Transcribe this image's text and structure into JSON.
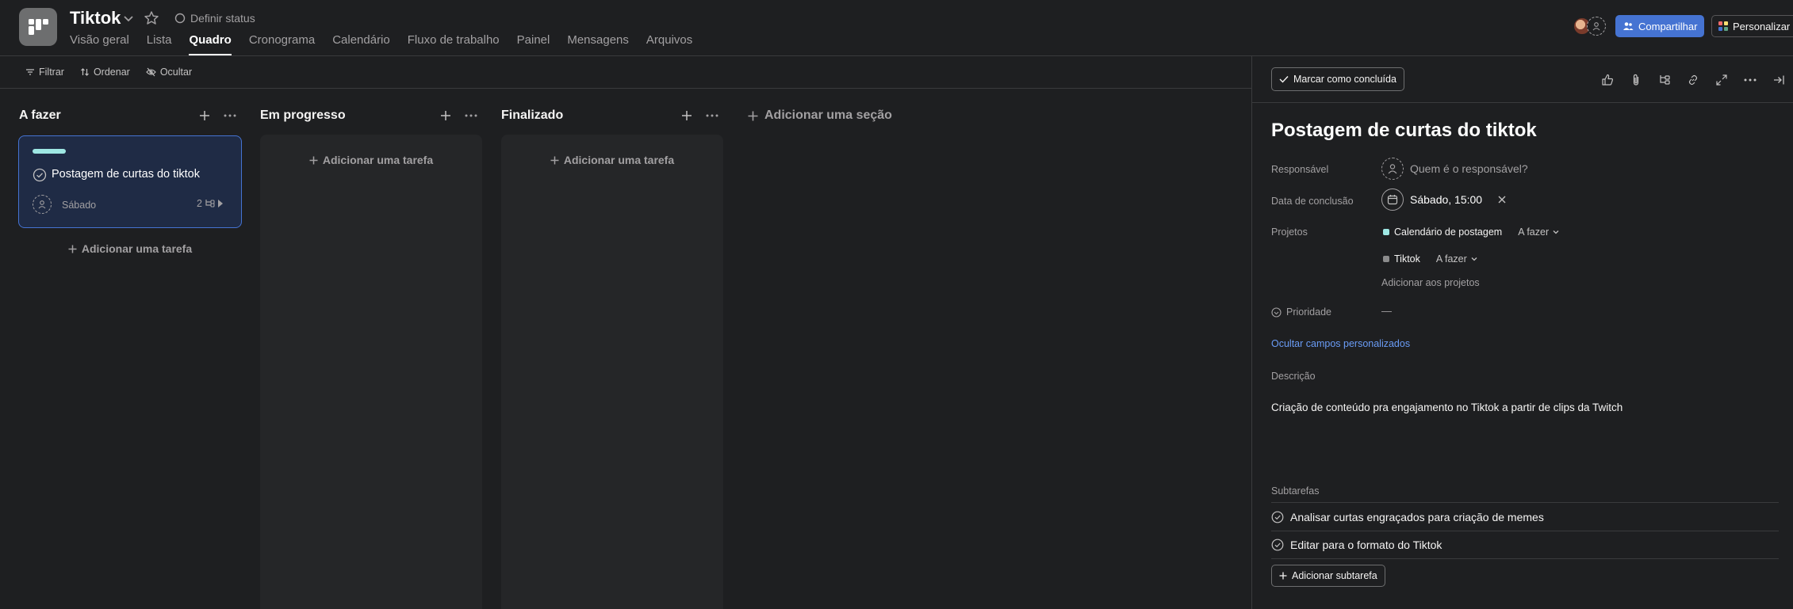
{
  "header": {
    "project_title": "Tiktok",
    "set_status": "Definir status",
    "tabs": [
      {
        "label": "Visão geral",
        "active": false
      },
      {
        "label": "Lista",
        "active": false
      },
      {
        "label": "Quadro",
        "active": true
      },
      {
        "label": "Cronograma",
        "active": false
      },
      {
        "label": "Calendário",
        "active": false
      },
      {
        "label": "Fluxo de trabalho",
        "active": false
      },
      {
        "label": "Painel",
        "active": false
      },
      {
        "label": "Mensagens",
        "active": false
      },
      {
        "label": "Arquivos",
        "active": false
      }
    ],
    "share_label": "Compartilhar",
    "customize_label": "Personalizar"
  },
  "toolbar": {
    "filter_label": "Filtrar",
    "sort_label": "Ordenar",
    "hide_label": "Ocultar"
  },
  "board": {
    "columns": [
      {
        "title": "A fazer",
        "add_task_label": "Adicionar uma tarefa"
      },
      {
        "title": "Em progresso",
        "add_task_label": "Adicionar uma tarefa"
      },
      {
        "title": "Finalizado",
        "add_task_label": "Adicionar uma tarefa"
      }
    ],
    "card": {
      "title": "Postagem de curtas do tiktok",
      "date": "Sábado",
      "subtask_count": "2",
      "tag_color": "#9ee7e3"
    },
    "add_section_label": "Adicionar uma seção"
  },
  "detail": {
    "mark_complete_label": "Marcar como concluída",
    "task_title": "Postagem de curtas do tiktok",
    "fields": {
      "assignee_label": "Responsável",
      "assignee_placeholder": "Quem é o responsável?",
      "due_label": "Data de conclusão",
      "due_value": "Sábado, 15:00",
      "projects_label": "Projetos",
      "projects": [
        {
          "name": "Calendário de postagem",
          "section": "A fazer",
          "color": "#9ee7e3"
        },
        {
          "name": "Tiktok",
          "section": "A fazer",
          "color": "#8b8b8c"
        }
      ],
      "add_to_projects": "Adicionar aos projetos",
      "priority_label": "Prioridade",
      "priority_value": "—"
    },
    "hide_custom_fields": "Ocultar campos personalizados",
    "description_label": "Descrição",
    "description_text": "Criação de conteúdo pra engajamento no Tiktok a partir de clips da Twitch",
    "subtasks_label": "Subtarefas",
    "subtasks": [
      "Analisar curtas engraçados para criação de memes",
      "Editar para o formato do Tiktok"
    ],
    "add_subtask_label": "Adicionar subtarefa"
  },
  "colors": {
    "accent": "#4573d2",
    "background": "#1e1f21",
    "column_bg": "#252628",
    "link": "#6a9cf6"
  }
}
